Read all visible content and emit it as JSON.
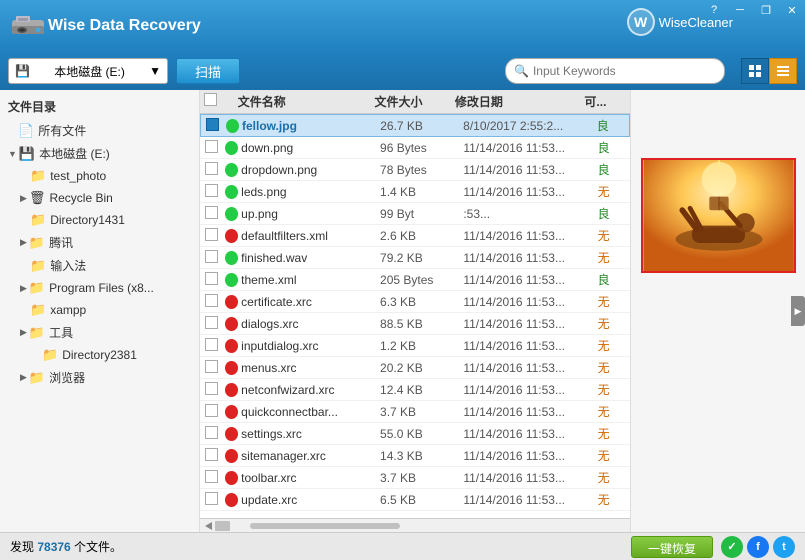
{
  "app": {
    "title": "Wise Data Recovery",
    "logo_letter": "W"
  },
  "wisecleaner": {
    "label": "WiseCleaner",
    "letter": "W"
  },
  "window_controls": {
    "minimize": "─",
    "maximize": "□",
    "close": "✕",
    "restore": "❐"
  },
  "toolbar": {
    "drive_label": "本地磁盘 (E:)",
    "scan_label": "扫描",
    "search_placeholder": "Input Keywords",
    "view1": "▦",
    "view2": "☰"
  },
  "sidebar": {
    "header": "文件目录",
    "items": [
      {
        "id": "all-files",
        "label": "所有文件",
        "level": 0,
        "icon": "📄",
        "arrow": false
      },
      {
        "id": "local-disk-e",
        "label": "本地磁盘 (E:)",
        "level": 0,
        "icon": "💾",
        "arrow": true,
        "expanded": true
      },
      {
        "id": "test_photo",
        "label": "test_photo",
        "level": 1,
        "icon": "📁",
        "arrow": false
      },
      {
        "id": "recycle-bin",
        "label": "Recycle Bin",
        "level": 1,
        "icon": "🗑",
        "arrow": true,
        "expanded": false
      },
      {
        "id": "directory1431",
        "label": "Directory1431",
        "level": 1,
        "icon": "📁",
        "arrow": false
      },
      {
        "id": "tencent",
        "label": "腾讯",
        "level": 1,
        "icon": "📁",
        "arrow": true
      },
      {
        "id": "input-method",
        "label": "输入法",
        "level": 1,
        "icon": "📁",
        "arrow": false
      },
      {
        "id": "program-files",
        "label": "Program Files (x8...",
        "level": 1,
        "icon": "📁",
        "arrow": true
      },
      {
        "id": "xampp",
        "label": "xampp",
        "level": 1,
        "icon": "📁",
        "arrow": false
      },
      {
        "id": "tools",
        "label": "工具",
        "level": 1,
        "icon": "📁",
        "arrow": true
      },
      {
        "id": "directory2381",
        "label": "Directory2381",
        "level": 2,
        "icon": "📁",
        "arrow": false
      },
      {
        "id": "browser",
        "label": "浏览器",
        "level": 1,
        "icon": "📁",
        "arrow": true
      }
    ]
  },
  "file_list": {
    "headers": [
      "文件名称",
      "文件大小",
      "修改日期",
      "可..."
    ],
    "files": [
      {
        "name": "fellow.jpg",
        "size": "26.7 KB",
        "date": "8/10/2017 2:55:2...",
        "status": "良",
        "dot": "green",
        "selected": true
      },
      {
        "name": "down.png",
        "size": "96 Bytes",
        "date": "11/14/2016 11:53...",
        "status": "良",
        "dot": "green",
        "selected": false
      },
      {
        "name": "dropdown.png",
        "size": "78 Bytes",
        "date": "11/14/2016 11:53...",
        "status": "良",
        "dot": "green",
        "selected": false
      },
      {
        "name": "leds.png",
        "size": "1.4 KB",
        "date": "11/14/2016 11:53...",
        "status": "无",
        "dot": "green",
        "selected": false
      },
      {
        "name": "up.png",
        "size": "99 Byt",
        "date": ":53...",
        "status": "良",
        "dot": "green",
        "selected": false
      },
      {
        "name": "defaultfilters.xml",
        "size": "2.6 KB",
        "date": "11/14/2016 11:53...",
        "status": "无",
        "dot": "red",
        "selected": false
      },
      {
        "name": "finished.wav",
        "size": "79.2 KB",
        "date": "11/14/2016 11:53...",
        "status": "无",
        "dot": "green",
        "selected": false
      },
      {
        "name": "theme.xml",
        "size": "205 Bytes",
        "date": "11/14/2016 11:53...",
        "status": "良",
        "dot": "green",
        "selected": false
      },
      {
        "name": "certificate.xrc",
        "size": "6.3 KB",
        "date": "11/14/2016 11:53...",
        "status": "无",
        "dot": "red",
        "selected": false
      },
      {
        "name": "dialogs.xrc",
        "size": "88.5 KB",
        "date": "11/14/2016 11:53...",
        "status": "无",
        "dot": "red",
        "selected": false
      },
      {
        "name": "inputdialog.xrc",
        "size": "1.2 KB",
        "date": "11/14/2016 11:53...",
        "status": "无",
        "dot": "red",
        "selected": false
      },
      {
        "name": "menus.xrc",
        "size": "20.2 KB",
        "date": "11/14/2016 11:53...",
        "status": "无",
        "dot": "red",
        "selected": false
      },
      {
        "name": "netconfwizard.xrc",
        "size": "12.4 KB",
        "date": "11/14/2016 11:53...",
        "status": "无",
        "dot": "red",
        "selected": false
      },
      {
        "name": "quickconnectbar...",
        "size": "3.7 KB",
        "date": "11/14/2016 11:53...",
        "status": "无",
        "dot": "red",
        "selected": false
      },
      {
        "name": "settings.xrc",
        "size": "55.0 KB",
        "date": "11/14/2016 11:53...",
        "status": "无",
        "dot": "red",
        "selected": false
      },
      {
        "name": "sitemanager.xrc",
        "size": "14.3 KB",
        "date": "11/14/2016 11:53...",
        "status": "无",
        "dot": "red",
        "selected": false
      },
      {
        "name": "toolbar.xrc",
        "size": "3.7 KB",
        "date": "11/14/2016 11:53...",
        "status": "无",
        "dot": "red",
        "selected": false
      },
      {
        "name": "update.xrc",
        "size": "6.5 KB",
        "date": "11/14/2016 11:53...",
        "status": "无",
        "dot": "red",
        "selected": false
      }
    ]
  },
  "statusbar": {
    "prefix": "发现 ",
    "count": "78376",
    "suffix": " 个文件。",
    "recover_label": "一键恢复"
  },
  "social": {
    "icons": [
      "✓",
      "f",
      "t"
    ]
  }
}
